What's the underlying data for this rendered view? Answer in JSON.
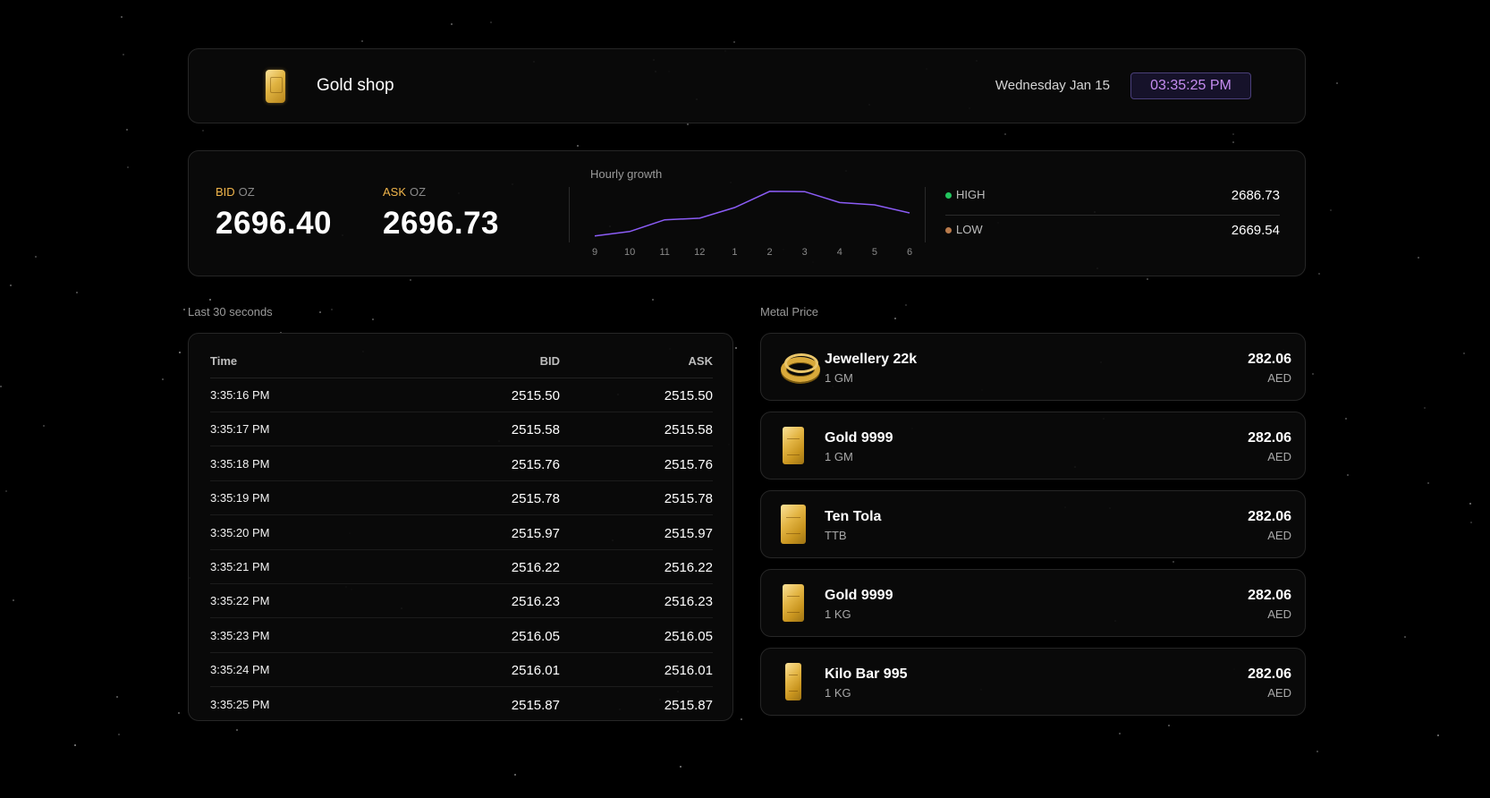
{
  "header": {
    "brand": "Gold shop",
    "logo_icon": "gold-bar-icon",
    "date": "Wednesday Jan 15",
    "time": "03:35:25 PM"
  },
  "ticker": {
    "bid": {
      "tag": "BID",
      "unit": "OZ",
      "value": "2696.40"
    },
    "ask": {
      "tag": "ASK",
      "unit": "OZ",
      "value": "2696.73"
    },
    "high": {
      "label": "HIGH",
      "value": "2686.73",
      "color": "#22c55e"
    },
    "low": {
      "label": "LOW",
      "value": "2669.54",
      "color": "#b87a4b"
    }
  },
  "chart_data": {
    "type": "line",
    "title": "Hourly growth",
    "x": [
      "9",
      "10",
      "11",
      "12",
      "1",
      "2",
      "3",
      "4",
      "5",
      "6"
    ],
    "series": [
      {
        "values": [
          2669.9,
          2671.6,
          2676.0,
          2676.6,
          2680.6,
          2686.7,
          2686.6,
          2682.5,
          2681.6,
          2678.6
        ]
      }
    ],
    "ylim": [
      2669.5,
      2687
    ],
    "color": "#8b5cf6",
    "grid": false
  },
  "table": {
    "label": "Last 30 seconds",
    "headers": {
      "time": "Time",
      "bid": "BID",
      "ask": "ASK"
    },
    "rows": [
      {
        "time": "3:35:16 PM",
        "bid": "2515.50",
        "ask": "2515.50"
      },
      {
        "time": "3:35:17 PM",
        "bid": "2515.58",
        "ask": "2515.58"
      },
      {
        "time": "3:35:18 PM",
        "bid": "2515.76",
        "ask": "2515.76"
      },
      {
        "time": "3:35:19 PM",
        "bid": "2515.78",
        "ask": "2515.78"
      },
      {
        "time": "3:35:20 PM",
        "bid": "2515.97",
        "ask": "2515.97"
      },
      {
        "time": "3:35:21 PM",
        "bid": "2516.22",
        "ask": "2516.22"
      },
      {
        "time": "3:35:22 PM",
        "bid": "2516.23",
        "ask": "2516.23"
      },
      {
        "time": "3:35:23 PM",
        "bid": "2516.05",
        "ask": "2516.05"
      },
      {
        "time": "3:35:24 PM",
        "bid": "2516.01",
        "ask": "2516.01"
      },
      {
        "time": "3:35:25 PM",
        "bid": "2515.87",
        "ask": "2515.87"
      }
    ]
  },
  "metals": {
    "label": "Metal Price",
    "items": [
      {
        "name": "Jewellery 22k",
        "unit": "1 GM",
        "price": "282.06",
        "currency": "AED",
        "icon": "gold-ring-icon"
      },
      {
        "name": "Gold 9999",
        "unit": "1 GM",
        "price": "282.06",
        "currency": "AED",
        "icon": "gold-bar-icon"
      },
      {
        "name": "Ten Tola",
        "unit": "TTB",
        "price": "282.06",
        "currency": "AED",
        "icon": "gold-bar-icon"
      },
      {
        "name": "Gold 9999",
        "unit": "1 KG",
        "price": "282.06",
        "currency": "AED",
        "icon": "gold-bar-icon"
      },
      {
        "name": "Kilo Bar 995",
        "unit": "1 KG",
        "price": "282.06",
        "currency": "AED",
        "icon": "gold-bar-icon"
      }
    ]
  }
}
